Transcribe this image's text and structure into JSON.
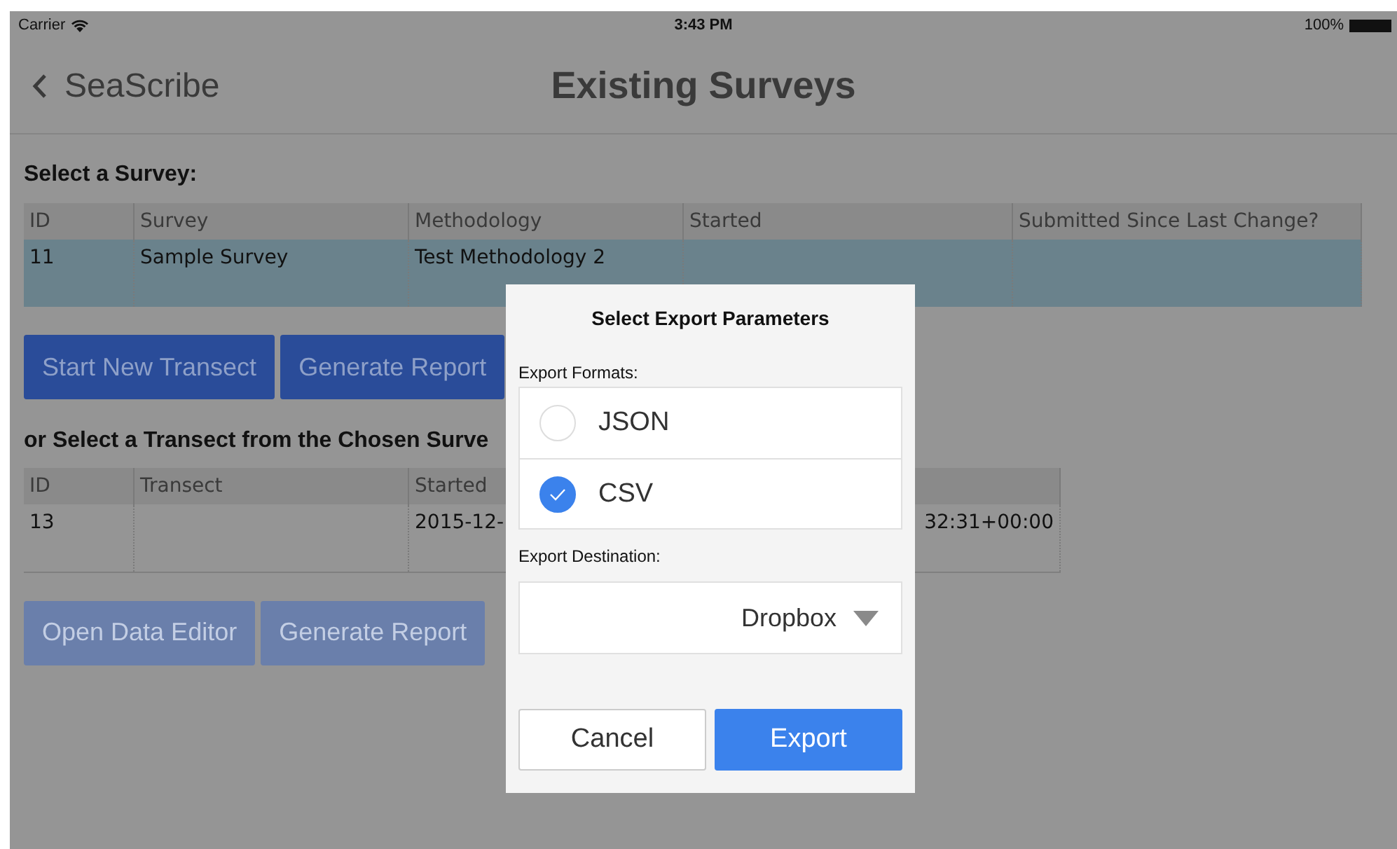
{
  "status_bar": {
    "carrier": "Carrier",
    "time": "3:43 PM",
    "battery": "100%"
  },
  "nav_bar": {
    "back_label": "SeaScribe",
    "title": "Existing Surveys"
  },
  "survey_section": {
    "heading": "Select a Survey:",
    "columns": [
      "ID",
      "Survey",
      "Methodology",
      "Started",
      "Submitted Since Last Change?"
    ],
    "rows": [
      {
        "cells": [
          "11",
          "Sample Survey",
          "Test Methodology 2",
          "",
          ""
        ],
        "selected": true
      }
    ],
    "buttons": [
      {
        "label": "Start New Transect",
        "disabled": false
      },
      {
        "label": "Generate Report",
        "disabled": false
      }
    ]
  },
  "transect_section": {
    "heading": "or Select a Transect from the Chosen Surve",
    "columns": [
      "ID",
      "Transect",
      "Started",
      ""
    ],
    "rows": [
      {
        "cells": [
          "13",
          "",
          "2015-12-",
          "32:31+00:00"
        ],
        "selected": false
      }
    ],
    "buttons": [
      {
        "label": "Open Data Editor",
        "disabled": true
      },
      {
        "label": "Generate Report",
        "disabled": true
      }
    ]
  },
  "dialog": {
    "title": "Select Export Parameters",
    "formats_label": "Export Formats:",
    "formats": [
      {
        "label": "JSON",
        "selected": false
      },
      {
        "label": "CSV",
        "selected": true
      }
    ],
    "destination_label": "Export Destination:",
    "destination": "Dropbox",
    "buttons": [
      {
        "label": "Cancel",
        "kind": "secondary"
      },
      {
        "label": "Export",
        "kind": "primary"
      }
    ]
  }
}
